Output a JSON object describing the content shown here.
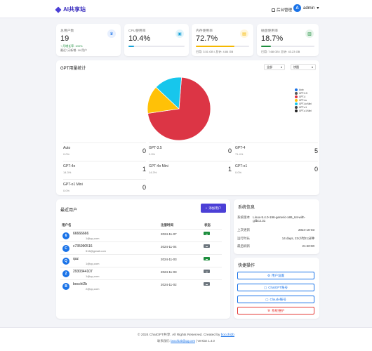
{
  "header": {
    "brand": "AI共享站",
    "admin_link": "后台管理",
    "user_initial": "A",
    "username": "admin"
  },
  "stats": [
    {
      "label": "总用户数",
      "value": "19",
      "sub1": "↑ 月增长率: 100%",
      "sub2": "最近7天新增: 18 用户",
      "icon": "users-icon",
      "icon_bg": "#e8f0fe",
      "icon_color": "#1a73e8"
    },
    {
      "label": "CPU使用率",
      "value": "10.4%",
      "progress": 0.104,
      "color": "#17a2d8",
      "icon": "cpu-icon",
      "icon_bg": "#e3f5fb",
      "icon_color": "#17a2d8"
    },
    {
      "label": "内存使用率",
      "value": "72.7%",
      "progress": 0.727,
      "color": "#f5b800",
      "sub1": "已用: 3.51 GB / 总计: 4.84 GB",
      "icon": "memory-icon",
      "icon_bg": "#fff6dc",
      "icon_color": "#f5b800"
    },
    {
      "label": "磁盘使用率",
      "value": "18.7%",
      "progress": 0.187,
      "color": "#1e8e3e",
      "sub1": "已用: 7.68 GB / 总计: 43.23 GB",
      "icon": "disk-icon",
      "icon_bg": "#e6f4ea",
      "icon_color": "#1e8e3e"
    }
  ],
  "gpt_stats": {
    "title": "GPT用量统计",
    "range_select": "全部",
    "type_select": "饼图",
    "colors": {
      "red": "#dc3545",
      "yellow": "#ffc107",
      "cyan": "#17c6ec"
    }
  },
  "chart_data": {
    "type": "pie",
    "categories": [
      "Auto",
      "GPT-3.5",
      "GPT-4",
      "GPT-4o",
      "GPT-4o Mini",
      "GPT-o1",
      "GPT-o1 Mini"
    ],
    "values": [
      0,
      0,
      5,
      1,
      1,
      0,
      0
    ],
    "legend_colors": [
      "#1a73e8",
      "#555555",
      "#dc3545",
      "#ffc107",
      "#17c6ec",
      "#444444",
      "#222222"
    ],
    "legend": "right"
  },
  "models": [
    {
      "name": "Auto",
      "pct": "0.0%",
      "count": "0"
    },
    {
      "name": "GPT-3.5",
      "pct": "0.0%",
      "count": "0"
    },
    {
      "name": "GPT-4",
      "pct": "71.4%",
      "count": "5"
    },
    {
      "name": "GPT-4o",
      "pct": "14.3%",
      "count": "1"
    },
    {
      "name": "GPT-4o Mini",
      "pct": "14.3%",
      "count": "1"
    },
    {
      "name": "GPT-o1",
      "pct": "0.0%",
      "count": "0"
    },
    {
      "name": "GPT-o1 Mini",
      "pct": "0.0%",
      "count": "0"
    }
  ],
  "recent_users": {
    "title": "最近用户",
    "add_button": "添加用户",
    "columns": [
      "用户名",
      "注册时间",
      "状态"
    ],
    "rows": [
      {
        "initial": "6",
        "name": "66666666",
        "email": "1@qq.com",
        "date": "2024-11-07",
        "status_color": "#1e8e3e"
      },
      {
        "initial": "C",
        "name": "c735990516",
        "email": "516@gmail.com",
        "date": "2024-11-04",
        "status_color": "#6c757d"
      },
      {
        "initial": "Q",
        "name": "qaz",
        "email": "1@qq.com",
        "date": "2024-11-03",
        "status_color": "#1e8e3e"
      },
      {
        "initial": "2",
        "name": "2930344107",
        "email": "1@qq.com",
        "date": "2024-11-03",
        "status_color": "#6c757d"
      },
      {
        "initial": "B",
        "name": "bocchi2b",
        "email": "2@qq.com",
        "date": "2024-11-02",
        "status_color": "#6c757d"
      }
    ]
  },
  "system_info": {
    "title": "系统信息",
    "rows": [
      {
        "label": "系统版本",
        "value": "Linux-5.4.0-196-generic-x86_64-with-glibc2.31"
      },
      {
        "label": "上次更新",
        "value": "2024-10-03"
      },
      {
        "label": "运行时长",
        "value": "14 days, 23小时21分钟"
      },
      {
        "label": "最后刷新",
        "value": "21:40:00"
      }
    ]
  },
  "quick_actions": {
    "title": "快捷操作",
    "buttons": [
      "用户设置",
      "ChatGPT账号",
      "Claude账号",
      "系统维护"
    ]
  },
  "footer": {
    "copyright": "© 2024 ChatGPT共享. All Rights Reserved. Created by",
    "creator": "bocchi2b",
    "contact_label": "联系我们:",
    "contact_email": "bocchi2b@qq.com",
    "version": "Version 1.4.0"
  }
}
